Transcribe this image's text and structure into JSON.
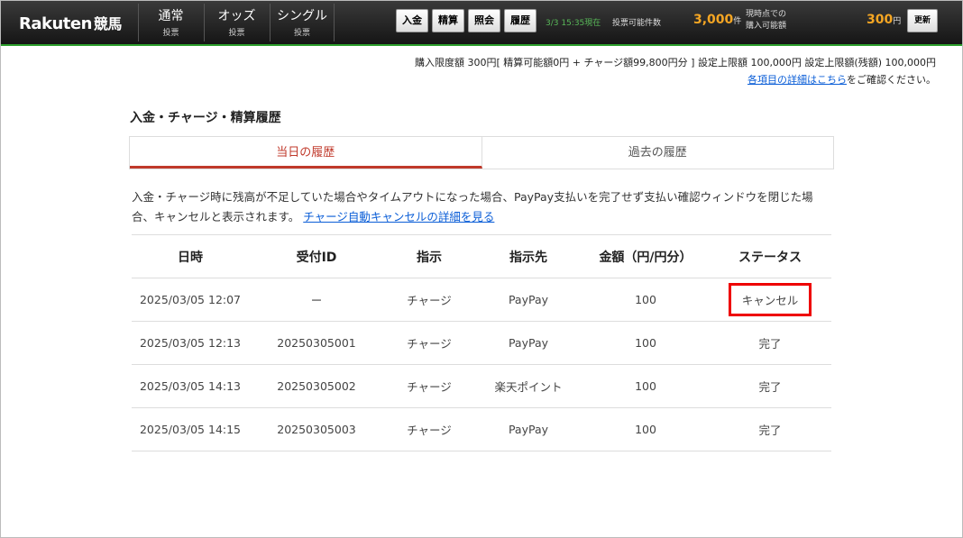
{
  "header": {
    "logo": "Rakuten",
    "logo_sub": "競馬",
    "tabs": [
      {
        "l1": "通常",
        "l2": "投票"
      },
      {
        "l1": "オッズ",
        "l2": "投票"
      },
      {
        "l1": "シングル",
        "l2": "投票"
      }
    ],
    "buttons": [
      "入金",
      "精算",
      "照会",
      "履歴"
    ],
    "time": "3/3 15:35現在",
    "vote_count_label": "投票可能件数",
    "vote_count": "3,000",
    "vote_count_unit": "件",
    "buyable_label_1": "現時点での",
    "buyable_label_2": "購入可能額",
    "buyable_amount": "300",
    "buyable_unit": "円",
    "refresh": "更新"
  },
  "limit_info": "購入限度額 300円[ 精算可能額0円 + チャージ額99,800円分 ] 設定上限額 100,000円 設定上限額(残額) 100,000円",
  "detail_link": "各項目の詳細はこちら",
  "detail_suffix": "をご確認ください。",
  "section_title": "入金・チャージ・精算履歴",
  "tabs": {
    "today": "当日の履歴",
    "past": "過去の履歴"
  },
  "description": "入金・チャージ時に残高が不足していた場合やタイムアウトになった場合、PayPay支払いを完了せず支払い確認ウィンドウを閉じた場合、キャンセルと表示されます。",
  "description_link": "チャージ自動キャンセルの詳細を見る",
  "table": {
    "headers": [
      "日時",
      "受付ID",
      "指示",
      "指示先",
      "金額（円/円分）",
      "ステータス"
    ],
    "rows": [
      [
        "2025/03/05 12:07",
        "ー",
        "チャージ",
        "PayPay",
        "100",
        "キャンセル"
      ],
      [
        "2025/03/05 12:13",
        "20250305001",
        "チャージ",
        "PayPay",
        "100",
        "完了"
      ],
      [
        "2025/03/05 14:13",
        "20250305002",
        "チャージ",
        "楽天ポイント",
        "100",
        "完了"
      ],
      [
        "2025/03/05 14:15",
        "20250305003",
        "チャージ",
        "PayPay",
        "100",
        "完了"
      ]
    ]
  }
}
